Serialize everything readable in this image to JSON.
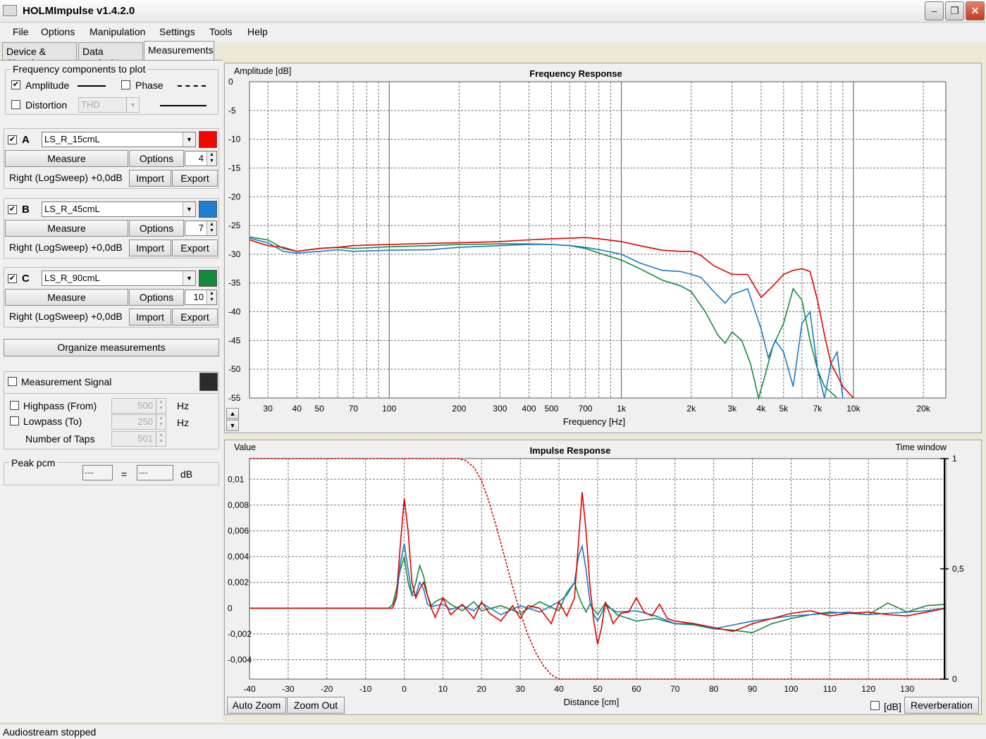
{
  "app": {
    "title": "HOLMImpulse  v1.4.2.0"
  },
  "window": {
    "minimize": "–",
    "maximize": "❐",
    "close": "✕"
  },
  "menu": [
    "File",
    "Options",
    "Manipulation",
    "Settings",
    "Tools",
    "Help"
  ],
  "tabs": [
    "Device & Signal",
    "Data analysis",
    "Measurements"
  ],
  "freq_group": {
    "title": "Frequency components to plot",
    "amplitude_label": "Amplitude",
    "amplitude_checked": "✔",
    "phase_label": "Phase",
    "phase_checked": "",
    "distortion_label": "Distortion",
    "distortion_checked": "",
    "distortion_value": "THD"
  },
  "measurements": [
    {
      "letter": "A",
      "checked": "✔",
      "name": "LS_R_15cmL",
      "color": "#ff0000",
      "measure_label": "Measure",
      "options_label": "Options",
      "smoothing": "4",
      "info": "Right (LogSweep) +0,0dB",
      "import_label": "Import",
      "export_label": "Export"
    },
    {
      "letter": "B",
      "checked": "✔",
      "name": "LS_R_45cmL",
      "color": "#1f7fcc",
      "measure_label": "Measure",
      "options_label": "Options",
      "smoothing": "7",
      "info": "Right (LogSweep) +0,0dB",
      "import_label": "Import",
      "export_label": "Export"
    },
    {
      "letter": "C",
      "checked": "✔",
      "name": "LS_R_90cmL",
      "color": "#138a3c",
      "measure_label": "Measure",
      "options_label": "Options",
      "smoothing": "10",
      "info": "Right (LogSweep) +0,0dB",
      "import_label": "Import",
      "export_label": "Export"
    }
  ],
  "organize_label": "Organize measurements",
  "signal": {
    "label": "Measurement Signal",
    "checked": "",
    "color": "#2b2b2b",
    "highpass_label": "Highpass (From)",
    "highpass_value": "500",
    "highpass_unit": "Hz",
    "lowpass_label": "Lowpass (To)",
    "lowpass_value": "250",
    "lowpass_unit": "Hz",
    "taps_label": "Number of Taps",
    "taps_value": "501"
  },
  "peak": {
    "title": "Peak pcm",
    "value1": "---",
    "equals": "=",
    "value2": "---",
    "unit": "dB"
  },
  "freq_chart": {
    "title": "Frequency Response",
    "ylabel": "Amplitude [dB]",
    "xlabel": "Frequency [Hz]",
    "scroll_up": "▲",
    "scroll_down": "▼"
  },
  "imp_chart": {
    "title": "Impulse Response",
    "ylabel": "Value",
    "y2label": "Time window",
    "xlabel": "Distance [cm]",
    "auto_zoom_label": "Auto Zoom",
    "zoom_out_label": "Zoom Out",
    "db_label": "[dB]",
    "db_checked": "",
    "reverb_label": "Reverberation"
  },
  "chart_data": [
    {
      "type": "line",
      "title": "Frequency Response",
      "xlabel": "Frequency [Hz]",
      "ylabel": "Amplitude [dB]",
      "xscale": "log",
      "xlim": [
        25,
        25000
      ],
      "ylim": [
        -55,
        0
      ],
      "grid": true,
      "xtick_labels": [
        "30",
        "40",
        "50",
        "70",
        "100",
        "200",
        "300",
        "400",
        "500",
        "700",
        "1k",
        "2k",
        "3k",
        "4k",
        "5k",
        "7k",
        "10k",
        "20k"
      ],
      "xtick_values": [
        30,
        40,
        50,
        70,
        100,
        200,
        300,
        400,
        500,
        700,
        1000,
        2000,
        3000,
        4000,
        5000,
        7000,
        10000,
        20000
      ],
      "ytick_values": [
        0,
        -5,
        -10,
        -15,
        -20,
        -25,
        -30,
        -35,
        -40,
        -45,
        -50,
        -55
      ],
      "ytick_labels": [
        "0",
        "-5",
        "-10",
        "-15",
        "-20",
        "-25",
        "-30",
        "-35",
        "-40",
        "-45",
        "-50",
        "-55"
      ],
      "series": [
        {
          "name": "LS_R_15cmL",
          "color": "#e00000",
          "x": [
            25,
            30,
            35,
            40,
            50,
            60,
            70,
            100,
            150,
            200,
            300,
            400,
            500,
            600,
            700,
            800,
            1000,
            1200,
            1500,
            1800,
            2000,
            2200,
            2500,
            3000,
            3500,
            4000,
            4500,
            5000,
            5500,
            6000,
            6500,
            7000,
            7500,
            8000,
            9000,
            10000
          ],
          "y": [
            -27.5,
            -28.5,
            -28.8,
            -29.5,
            -29,
            -28.8,
            -28.5,
            -28.3,
            -28.1,
            -28,
            -27.8,
            -27.5,
            -27.3,
            -27.2,
            -27.1,
            -27.3,
            -27.8,
            -28.5,
            -29.3,
            -29.5,
            -29.5,
            -30.2,
            -32,
            -33.5,
            -33.5,
            -37.5,
            -35.5,
            -33.5,
            -32.8,
            -32.5,
            -33,
            -38,
            -44,
            -49,
            -53,
            -55
          ]
        },
        {
          "name": "LS_R_45cmL",
          "color": "#1a7ac4",
          "x": [
            25,
            30,
            35,
            40,
            50,
            60,
            70,
            100,
            150,
            200,
            300,
            400,
            500,
            600,
            700,
            800,
            1000,
            1200,
            1500,
            1800,
            2000,
            2200,
            2500,
            2800,
            3000,
            3500,
            4000,
            4300,
            4600,
            5000,
            5500,
            6000,
            6500,
            7000,
            7500,
            8000,
            8500,
            9000
          ],
          "y": [
            -27.2,
            -28,
            -29.5,
            -29.8,
            -29.5,
            -29.2,
            -29.5,
            -29.3,
            -29.2,
            -28.8,
            -28.5,
            -28.3,
            -28.3,
            -28.5,
            -28.8,
            -29.2,
            -30,
            -31.5,
            -32.8,
            -33,
            -33.5,
            -34,
            -36.5,
            -38.5,
            -37,
            -36,
            -43,
            -48,
            -45,
            -47,
            -53,
            -42,
            -40,
            -50,
            -55,
            -49,
            -47,
            -55
          ]
        },
        {
          "name": "LS_R_90cmL",
          "color": "#168a40",
          "x": [
            25,
            30,
            35,
            40,
            50,
            60,
            70,
            100,
            150,
            200,
            300,
            400,
            500,
            600,
            700,
            800,
            1000,
            1200,
            1500,
            1800,
            2000,
            2300,
            2600,
            2800,
            3000,
            3300,
            3600,
            3900,
            4100,
            4500,
            5000,
            5500,
            6000,
            6500,
            7000,
            7500,
            8000,
            8500
          ],
          "y": [
            -27,
            -27.5,
            -29,
            -29.5,
            -29,
            -28.8,
            -29,
            -28.7,
            -28.5,
            -28.3,
            -28.2,
            -28.2,
            -28.3,
            -28.5,
            -29,
            -29.8,
            -31,
            -32.5,
            -34.5,
            -35.5,
            -36.5,
            -40,
            -44,
            -45.5,
            -43.5,
            -45,
            -49,
            -55,
            -52,
            -46,
            -42,
            -36,
            -38,
            -45,
            -50,
            -53,
            -54,
            -55
          ]
        }
      ]
    },
    {
      "type": "line",
      "title": "Impulse Response",
      "xlabel": "Distance [cm]",
      "ylabel": "Value",
      "y2label": "Time window",
      "xlim": [
        -40,
        140
      ],
      "ylim": [
        -0.0055,
        0.0116
      ],
      "y2lim": [
        0,
        1
      ],
      "grid": true,
      "xtick_values": [
        -40,
        -30,
        -20,
        -10,
        0,
        10,
        20,
        30,
        40,
        50,
        60,
        70,
        80,
        90,
        100,
        110,
        120,
        130
      ],
      "xtick_labels": [
        "-40",
        "-30",
        "-20",
        "-10",
        "0",
        "10",
        "20",
        "30",
        "40",
        "50",
        "60",
        "70",
        "80",
        "90",
        "100",
        "110",
        "120",
        "130"
      ],
      "ytick_values": [
        0.01,
        0.008,
        0.006,
        0.004,
        0.002,
        0,
        -0.002,
        -0.004
      ],
      "ytick_labels": [
        "0,01",
        "0,008",
        "0,006",
        "0,004",
        "0,002",
        "0",
        "-0,002",
        "-0,004"
      ],
      "y2tick_values": [
        1,
        0.5,
        0
      ],
      "y2tick_labels": [
        "1",
        "0,5",
        "0"
      ],
      "window": {
        "name": "Time window",
        "color": "#cc0000",
        "x": [
          -40,
          14,
          16,
          18,
          20,
          22,
          24,
          26,
          28,
          30,
          32,
          34,
          36,
          38,
          40,
          140
        ],
        "y": [
          1,
          1,
          0.99,
          0.96,
          0.9,
          0.8,
          0.68,
          0.55,
          0.42,
          0.3,
          0.2,
          0.12,
          0.06,
          0.02,
          0,
          0
        ]
      },
      "series": [
        {
          "name": "LS_R_15cmL",
          "color": "#e00000",
          "x": [
            -40,
            -3,
            -2,
            -1,
            0,
            1,
            2,
            3,
            4,
            5,
            6,
            7,
            8,
            9,
            10,
            12,
            15,
            18,
            20,
            22,
            25,
            28,
            30,
            32,
            35,
            38,
            40,
            42,
            44,
            45,
            46,
            47,
            48,
            49,
            50,
            51,
            52,
            54,
            56,
            58,
            60,
            62,
            64,
            66,
            68,
            70,
            75,
            80,
            85,
            90,
            95,
            100,
            105,
            110,
            115,
            120,
            125,
            130,
            135,
            140
          ],
          "y": [
            0,
            0,
            0.001,
            0.005,
            0.0085,
            0.006,
            0.002,
            0.0008,
            0.0015,
            0.002,
            0.001,
            0,
            -0.0007,
            0,
            0.0008,
            -0.0005,
            0.0003,
            -0.0008,
            0.0005,
            -0.0004,
            -0.001,
            0.0002,
            -0.0008,
            0.0002,
            0,
            -0.0012,
            0.0005,
            -0.0006,
            0.0008,
            0.005,
            0.009,
            0.006,
            0.0018,
            -0.001,
            -0.0028,
            -0.0015,
            0.0005,
            -0.0012,
            -0.0004,
            -0.0003,
            0.0008,
            -0.0003,
            -0.0006,
            0.0003,
            -0.0008,
            -0.001,
            -0.0012,
            -0.0015,
            -0.0018,
            -0.0012,
            -0.0008,
            -0.0004,
            -0.0002,
            -0.0006,
            -0.0004,
            -0.0003,
            -0.0005,
            -0.0006,
            -0.0003,
            0
          ]
        },
        {
          "name": "LS_R_45cmL",
          "color": "#1a7ac4",
          "x": [
            -40,
            -3,
            -2,
            -1,
            0,
            1,
            2,
            3,
            4,
            5,
            6,
            7,
            8,
            10,
            12,
            15,
            18,
            20,
            25,
            30,
            35,
            40,
            42,
            44,
            45,
            46,
            47,
            48,
            49,
            50,
            52,
            55,
            60,
            65,
            70,
            75,
            80,
            85,
            90,
            95,
            100,
            105,
            110,
            115,
            120,
            125,
            130,
            135,
            140
          ],
          "y": [
            0,
            0,
            0.0008,
            0.0035,
            0.005,
            0.003,
            0.001,
            0.001,
            0.002,
            0.0015,
            0.0003,
            0.0001,
            0.0002,
            0.0003,
            -0.0001,
            0.0002,
            -0.0002,
            0.0004,
            -0.0005,
            0.0002,
            -0.0003,
            0.0005,
            0.001,
            0.002,
            0.004,
            0.0048,
            0.003,
            0.0005,
            -0.0005,
            -0.001,
            0.0002,
            -0.0003,
            -0.0002,
            -0.0006,
            -0.0012,
            -0.0012,
            -0.0016,
            -0.0013,
            -0.001,
            -0.0008,
            -0.0006,
            -0.0005,
            -0.0004,
            -0.0003,
            -0.0005,
            -0.0004,
            -0.0003,
            -0.0002,
            0
          ]
        },
        {
          "name": "LS_R_90cmL",
          "color": "#168a40",
          "x": [
            -40,
            -4,
            -3,
            -2,
            -1,
            0,
            1,
            2,
            3,
            4,
            5,
            6,
            7,
            8,
            10,
            12,
            15,
            18,
            20,
            25,
            30,
            35,
            40,
            42,
            44,
            45,
            46,
            47,
            48,
            50,
            52,
            55,
            60,
            65,
            70,
            75,
            80,
            85,
            90,
            95,
            100,
            105,
            110,
            115,
            120,
            125,
            130,
            135,
            140
          ],
          "y": [
            0,
            0,
            0.0003,
            0.0015,
            0.003,
            0.004,
            0.002,
            0.001,
            0.002,
            0.0033,
            0.0025,
            0.001,
            0.0002,
            0.0005,
            0.0008,
            0.0003,
            -0.0002,
            0.0005,
            -0.0002,
            0.0002,
            -0.0004,
            0.0005,
            -0.0002,
            0.0012,
            0.002,
            0.001,
            0.0003,
            -0.0003,
            0.0003,
            -0.0005,
            0.0004,
            -0.0005,
            -0.001,
            -0.0008,
            -0.0012,
            -0.0013,
            -0.0016,
            -0.0017,
            -0.0019,
            -0.0012,
            -0.0008,
            -0.0005,
            -0.0003,
            -0.0004,
            -0.0005,
            0.0004,
            -0.0003,
            0.0002,
            0.0003
          ]
        }
      ]
    }
  ],
  "status": "Audiostream stopped"
}
